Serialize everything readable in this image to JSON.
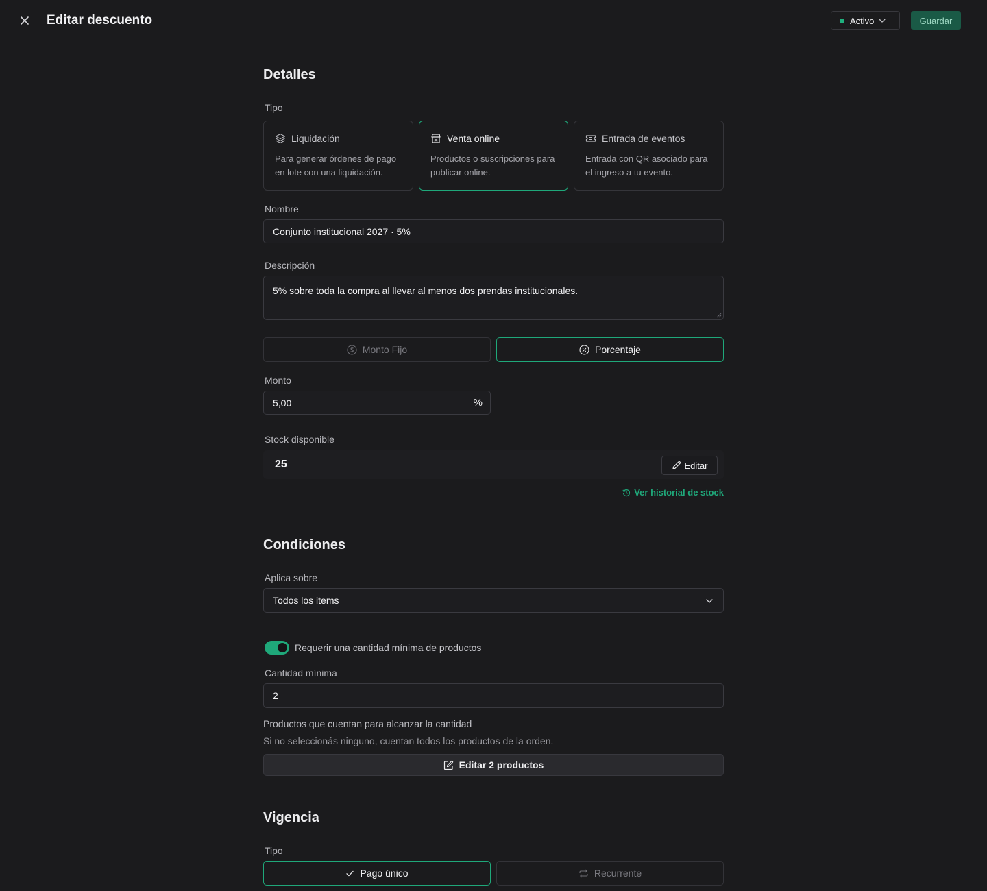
{
  "header": {
    "title": "Editar descuento",
    "status_label": "Activo",
    "save_label": "Guardar"
  },
  "details": {
    "heading": "Detalles",
    "type_label": "Tipo",
    "type_options": [
      {
        "icon": "layers-icon",
        "title": "Liquidación",
        "description": "Para generar órdenes de pago en lote con una liquidación.",
        "selected": false
      },
      {
        "icon": "store-icon",
        "title": "Venta online",
        "description": "Productos o suscripciones para publicar online.",
        "selected": true
      },
      {
        "icon": "ticket-icon",
        "title": "Entrada de eventos",
        "description": "Entrada con QR asociado para el ingreso a tu evento.",
        "selected": false
      }
    ],
    "name_label": "Nombre",
    "name_value": "Conjunto institucional 2027 · 5%",
    "description_label": "Descripción",
    "description_value": "5% sobre toda la compra al llevar al menos dos prendas institucionales.",
    "mode_fixed": "Monto Fijo",
    "mode_percent": "Porcentaje",
    "mode_selected": "Porcentaje",
    "amount_label": "Monto",
    "amount_value": "5,00",
    "amount_suffix": "%",
    "stock_label": "Stock disponible",
    "stock_value": "25",
    "stock_edit_label": "Editar",
    "stock_history_label": "Ver historial de stock"
  },
  "conditions": {
    "heading": "Condiciones",
    "applies_label": "Aplica sobre",
    "applies_value": "Todos los items",
    "min_toggle_label": "Requerir una cantidad mínima de productos",
    "min_toggle_on": true,
    "min_qty_label": "Cantidad mínima",
    "min_qty_value": "2",
    "products_title": "Productos que cuentan para alcanzar la cantidad",
    "products_hint": "Si no seleccionás ninguno, cuentan todos los productos de la orden.",
    "edit_products_label": "Editar 2 productos"
  },
  "validity": {
    "heading": "Vigencia",
    "type_label": "Tipo",
    "once_label": "Pago único",
    "recurring_label": "Recurrente",
    "selected": "Pago único"
  },
  "colors": {
    "background": "#1b1b1d",
    "accent": "#1fa87a",
    "save_button": "#1a5a46"
  }
}
